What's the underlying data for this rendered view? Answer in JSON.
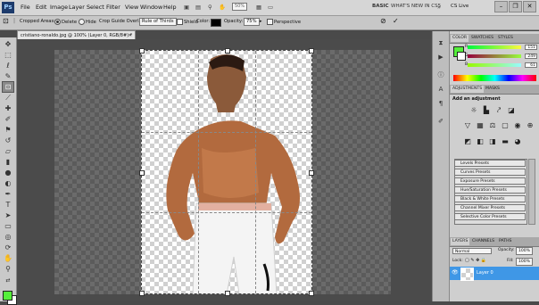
{
  "menubar": {
    "logo": "Ps",
    "items": [
      "File",
      "Edit",
      "Image",
      "Layer",
      "Select",
      "Filter",
      "View",
      "Window",
      "Help"
    ],
    "zoom": "50%",
    "workspace": "BASIC",
    "whats_new": "WHAT'S NEW IN CS5",
    "cs_live": "CS Live"
  },
  "options": {
    "cropped_areas_label": "Cropped Areas:",
    "delete_label": "Delete",
    "hide_label": "Hide",
    "overlay_label": "Crop Guide Overlay:",
    "overlay_value": "Rule of Thirds",
    "shield_label": "Shield",
    "color_label": "Color:",
    "opacity_label": "Opacity:",
    "opacity_value": "75%",
    "perspective_label": "Perspective"
  },
  "document": {
    "tab_title": "cristiano-ronaldo.jpg @ 100% (Layer 0, RGB/8#) *"
  },
  "color_panel": {
    "tabs": [
      "COLOR",
      "SWATCHES",
      "STYLES"
    ],
    "r_value": "151",
    "g_value": "249",
    "b_value": "61",
    "r_label": "R",
    "g_label": "G",
    "b_label": "B",
    "fg_color": "#55ef3b"
  },
  "adjustments_panel": {
    "tabs": [
      "ADJUSTMENTS",
      "MASKS"
    ],
    "heading": "Add an adjustment",
    "presets": [
      "Levels Presets",
      "Curves Presets",
      "Exposure Presets",
      "Hue/Saturation Presets",
      "Black & White Presets",
      "Channel Mixer Presets",
      "Selective Color Presets"
    ]
  },
  "layers_panel": {
    "tabs": [
      "LAYERS",
      "CHANNELS",
      "PATHS"
    ],
    "blend_mode": "Normal",
    "opacity_label": "Opacity:",
    "opacity_value": "100%",
    "lock_label": "Lock:",
    "fill_label": "Fill:",
    "fill_value": "100%",
    "layer_name": "Layer 0"
  },
  "colors": {
    "accent": "#3f97e6",
    "foreground": "#55ef3b"
  }
}
